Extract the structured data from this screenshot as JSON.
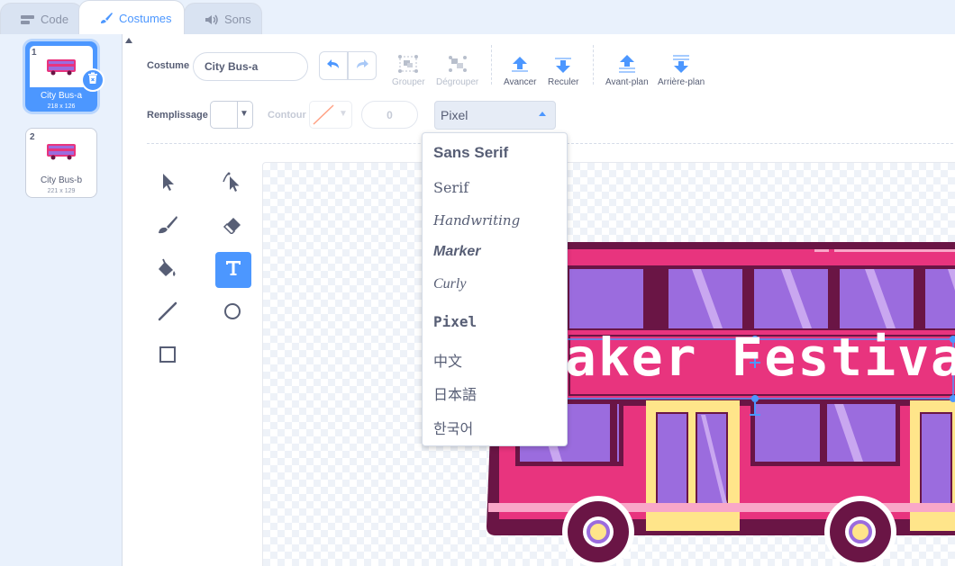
{
  "tabs": [
    {
      "label": "Code",
      "icon": "code-icon",
      "active": false
    },
    {
      "label": "Costumes",
      "icon": "paintbrush-icon",
      "active": true
    },
    {
      "label": "Sons",
      "icon": "speaker-icon",
      "active": false
    }
  ],
  "costumes": [
    {
      "number": "1",
      "name": "City Bus-a",
      "size": "218 x 126",
      "selected": true
    },
    {
      "number": "2",
      "name": "City Bus-b",
      "size": "221 x 129",
      "selected": false
    }
  ],
  "toolbar": {
    "costume_label": "Costume",
    "costume_name": "City Bus-a",
    "group_label": "Grouper",
    "ungroup_label": "Dégrouper",
    "forward_label": "Avancer",
    "backward_label": "Reculer",
    "front_label": "Avant-plan",
    "back_label": "Arrière-plan",
    "fill_label": "Remplissage",
    "outline_label": "Contour",
    "outline_width": "0",
    "font_selected": "Pixel"
  },
  "font_menu": {
    "items": [
      "Sans Serif",
      "Serif",
      "Handwriting",
      "Marker",
      "Curly",
      "Pixel",
      "中文",
      "日本語",
      "한국어"
    ]
  },
  "canvas": {
    "text": "Maker Festival"
  },
  "colors": {
    "accent": "#4c97ff",
    "bus_pink": "#e8347e",
    "bus_dark": "#6a1545",
    "window_purple": "#9b6cde",
    "door_yellow": "#ffe58a"
  }
}
